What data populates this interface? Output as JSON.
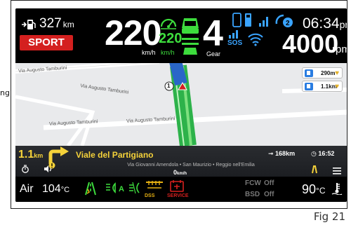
{
  "side_text": "ngl",
  "figure_label": "Fig 21",
  "colors": {
    "accent_green": "#3ddc3d",
    "sport_red": "#d4201f",
    "nav_yellow": "#f5d23a",
    "blue": "#3aa4ff"
  },
  "top": {
    "range_value": "327",
    "range_unit": "km",
    "drive_mode": "SPORT",
    "speed": "220",
    "speed_unit": "km/h",
    "acc_speed": "220",
    "acc_unit": "km/h",
    "gear": "4",
    "gear_label": "Gear",
    "sos_label": "SOS",
    "time_value": "06:34",
    "time_suffix": "pm",
    "rpm": "4000",
    "rpm_unit": "rpm",
    "icons": [
      "fuel-pump-icon",
      "acc-gauge-icon",
      "lane-assist-car-icon",
      "phone-icon",
      "battery-icon",
      "signal-bars-icon",
      "bluetooth-devices-icon",
      "sos-signal-icon",
      "wifi-icon"
    ]
  },
  "map": {
    "street_labels": [
      "Via Augusto Tamburini",
      "Via Augusto Tamburini",
      "Via Augusto Tamburini",
      "Via Augusto Tamburini"
    ],
    "route_marker": "1",
    "poi_distances": [
      "290m",
      "1.1km"
    ]
  },
  "nav": {
    "turn_distance": "1.1",
    "turn_distance_unit": "km",
    "street_name": "Viale del Partigiano",
    "remaining_distance": "168km",
    "arrival_time": "16:52",
    "via_text": "Via Giovanni Amendola • San Maurizio • Reggio nell'Emilia",
    "road_speed": "0",
    "road_speed_unit": "km/h"
  },
  "bottom": {
    "air_label": "Air",
    "air_temp": "104",
    "air_unit": "°C",
    "dss_label": "DSS",
    "service_label": "SERVICE",
    "fcw_label": "FCW",
    "fcw_value": "Off",
    "bsd_label": "BSD",
    "bsd_value": "Off",
    "coolant_temp": "90",
    "coolant_unit": "°C"
  }
}
